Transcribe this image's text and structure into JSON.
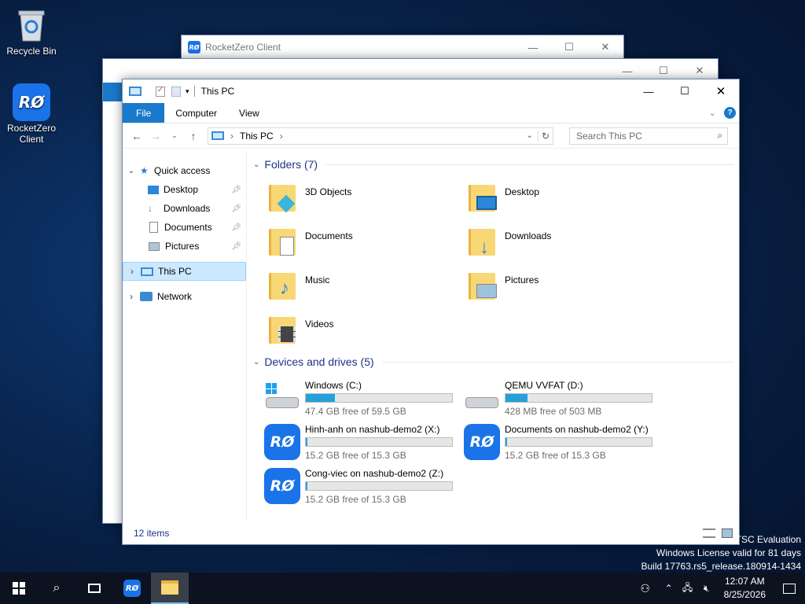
{
  "desktop": {
    "recycle_bin": "Recycle Bin",
    "rocketzero_label1": "RocketZero",
    "rocketzero_label2": "Client"
  },
  "bg_window": {
    "title": "RocketZero Client"
  },
  "explorer": {
    "title": "This PC",
    "tabs": {
      "file": "File",
      "computer": "Computer",
      "view": "View"
    },
    "address": "This PC",
    "search_placeholder": "Search This PC",
    "nav": {
      "quick_access": "Quick access",
      "desktop": "Desktop",
      "downloads": "Downloads",
      "documents": "Documents",
      "pictures": "Pictures",
      "this_pc": "This PC",
      "network": "Network"
    },
    "folders_header": "Folders (7)",
    "folders": [
      "3D Objects",
      "Desktop",
      "Documents",
      "Downloads",
      "Music",
      "Pictures",
      "Videos"
    ],
    "drives_header": "Devices and drives (5)",
    "drives": [
      {
        "name": "Windows (C:)",
        "free": "47.4 GB free of 59.5 GB",
        "used_fraction": 0.2
      },
      {
        "name": "QEMU VVFAT (D:)",
        "free": "428 MB free of 503 MB",
        "used_fraction": 0.15
      },
      {
        "name": "Hinh-anh on nashub-demo2 (X:)",
        "free": "15.2 GB free of 15.3 GB",
        "used_fraction": 0.01
      },
      {
        "name": "Documents on nashub-demo2 (Y:)",
        "free": "15.2 GB free of 15.3 GB",
        "used_fraction": 0.01
      },
      {
        "name": "Cong-viec on nashub-demo2 (Z:)",
        "free": "15.2 GB free of 15.3 GB",
        "used_fraction": 0.01
      }
    ],
    "status": "12 items"
  },
  "watermark": {
    "line1": "TSC Evaluation",
    "line2": "Windows License valid for 81 days",
    "line3": "Build 17763.rs5_release.180914-1434"
  },
  "taskbar": {
    "time": "12:07 AM",
    "date": "8/25/2026"
  },
  "colors": {
    "accent": "#1979ca",
    "bar_fill": "#26a0da",
    "rocketzero": "#1a73e8"
  }
}
